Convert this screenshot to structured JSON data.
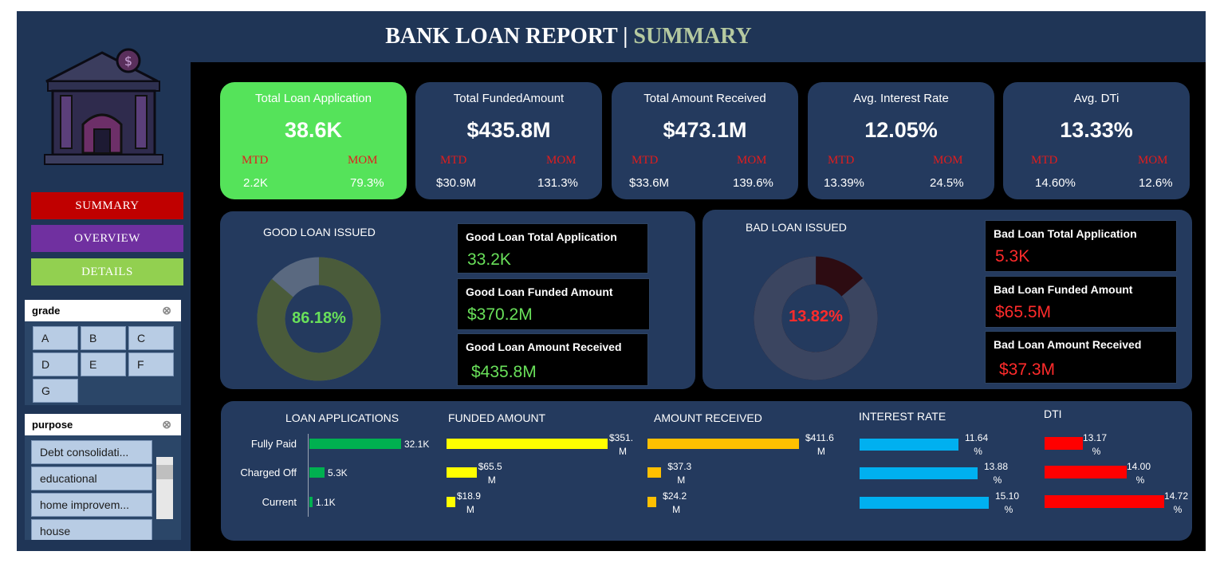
{
  "header": {
    "title_main": "BANK LOAN REPORT |",
    "title_highlight": " SUMMARY"
  },
  "nav": {
    "summary": "SUMMARY",
    "overview": "OVERVIEW",
    "details": "DETAILS",
    "colors": {
      "summary": "#c00000",
      "overview": "#7030a0",
      "details": "#92d050"
    }
  },
  "slicers": {
    "grade": {
      "title": "grade",
      "options": [
        "A",
        "B",
        "C",
        "D",
        "E",
        "F",
        "G"
      ]
    },
    "purpose": {
      "title": "purpose",
      "options": [
        "Debt consolidati...",
        "educational",
        "home improvem...",
        "house"
      ]
    }
  },
  "kpis": [
    {
      "label": "Total Loan Application",
      "value": "38.6K",
      "mtd_label": "MTD",
      "mom_label": "MOM",
      "mtd": "2.2K",
      "mom": "79.3%",
      "bg": "#55e35a"
    },
    {
      "label": "Total FundedAmount",
      "value": "$435.8M",
      "mtd_label": "MTD",
      "mom_label": "MOM",
      "mtd": "$30.9M",
      "mom": "131.3%",
      "bg": "#243a5e"
    },
    {
      "label": "Total Amount  Received",
      "value": "$473.1M",
      "mtd_label": "MTD",
      "mom_label": "MOM",
      "mtd": "$33.6M",
      "mom": "139.6%",
      "bg": "#243a5e"
    },
    {
      "label": "Avg. Interest Rate",
      "value": "12.05%",
      "mtd_label": "MTD",
      "mom_label": "MOM",
      "mtd": "13.39%",
      "mom": "24.5%",
      "bg": "#243a5e"
    },
    {
      "label": "Avg. DTi",
      "value": "13.33%",
      "mtd_label": "MTD",
      "mom_label": "MOM",
      "mtd": "14.60%",
      "mom": "12.6%",
      "bg": "#243a5e"
    }
  ],
  "good_loan": {
    "title": "GOOD LOAN ISSUED",
    "percent": "86.18%",
    "percent_value": 86.18,
    "cards": [
      {
        "label": "Good Loan Total Application",
        "value": "33.2K"
      },
      {
        "label": "Good Loan Funded Amount",
        "value": "$370.2M"
      },
      {
        "label": "Good Loan Amount Received",
        "value": "$435.8M"
      }
    ]
  },
  "bad_loan": {
    "title": "BAD LOAN ISSUED",
    "percent": "13.82%",
    "percent_value": 13.82,
    "cards": [
      {
        "label": "Bad Loan Total Application",
        "value": "5.3K"
      },
      {
        "label": "Bad Loan Funded Amount",
        "value": "$65.5M"
      },
      {
        "label": "Bad Loan Amount Received",
        "value": "$37.3M"
      }
    ]
  },
  "chart_data": [
    {
      "type": "bar",
      "title": "LOAN APPLICATIONS",
      "categories": [
        "Fully Paid",
        "Charged Off",
        "Current"
      ],
      "values": [
        32.1,
        5.3,
        1.1
      ],
      "labels": [
        "32.1K",
        "5.3K",
        "1.1K"
      ],
      "color": "#00b050"
    },
    {
      "type": "bar",
      "title": "FUNDED AMOUNT",
      "categories": [
        "Fully Paid",
        "Charged Off",
        "Current"
      ],
      "values": [
        351,
        65.5,
        18.9
      ],
      "labels": [
        "$351.\nM",
        "$65.5\nM",
        "$18.9\nM"
      ],
      "color": "#ffff00"
    },
    {
      "type": "bar",
      "title": "AMOUNT RECEIVED",
      "categories": [
        "Fully Paid",
        "Charged Off",
        "Current"
      ],
      "values": [
        411.6,
        37.3,
        24.2
      ],
      "labels": [
        "$411.6\nM",
        "$37.3\nM",
        "$24.2\nM"
      ],
      "color": "#ffc000"
    },
    {
      "type": "bar",
      "title": "INTEREST RATE",
      "categories": [
        "Fully Paid",
        "Charged Off",
        "Current"
      ],
      "values": [
        11.64,
        13.88,
        15.1
      ],
      "labels": [
        "11.64\n%",
        "13.88\n%",
        "15.10\n%"
      ],
      "color": "#00b0f0"
    },
    {
      "type": "bar",
      "title": "DTI",
      "categories": [
        "Fully Paid",
        "Charged Off",
        "Current"
      ],
      "values": [
        13.17,
        14.0,
        14.72
      ],
      "labels": [
        "13.17\n%",
        "14.00\n%",
        "14.72\n%"
      ],
      "color": "#ff0000"
    }
  ]
}
